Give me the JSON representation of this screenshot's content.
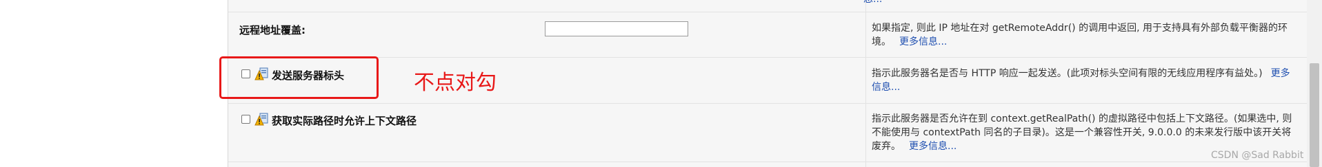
{
  "top_row": {
    "more_fragment": "息..."
  },
  "rows": [
    {
      "label": "远程地址覆盖:",
      "input_value": "",
      "description": "如果指定, 则此 IP 地址在对 getRemoteAddr() 的调用中返回, 用于支持具有外部负载平衡器的环境。",
      "more_link": "更多信息..."
    },
    {
      "label": "发送服务器标头",
      "checked": false,
      "icon": "warning-icon",
      "description": "指示此服务器名是否与 HTTP 响应一起发送。(此项对标头空间有限的无线应用程序有益处。)",
      "more_link": "更多信息..."
    },
    {
      "label": "获取实际路径时允许上下文路径",
      "checked": false,
      "icon": "warning-icon",
      "description": "指示此服务器是否允许在到 context.getRealPath() 的虚拟路径中包括上下文路径。(如果选中, 则不能使用与 contextPath 同名的子目录)。这是一个兼容性开关, 9.0.0.0 的未来发行版中该开关将废弃。",
      "more_link": "更多信息..."
    }
  ],
  "annotation": {
    "text": "不点对勾",
    "color": "#e81818"
  },
  "watermark": "CSDN @Sad Rabbit",
  "colors": {
    "link": "#1f4fb0",
    "panel": "#f6f6f6",
    "highlight": "#e81818"
  }
}
